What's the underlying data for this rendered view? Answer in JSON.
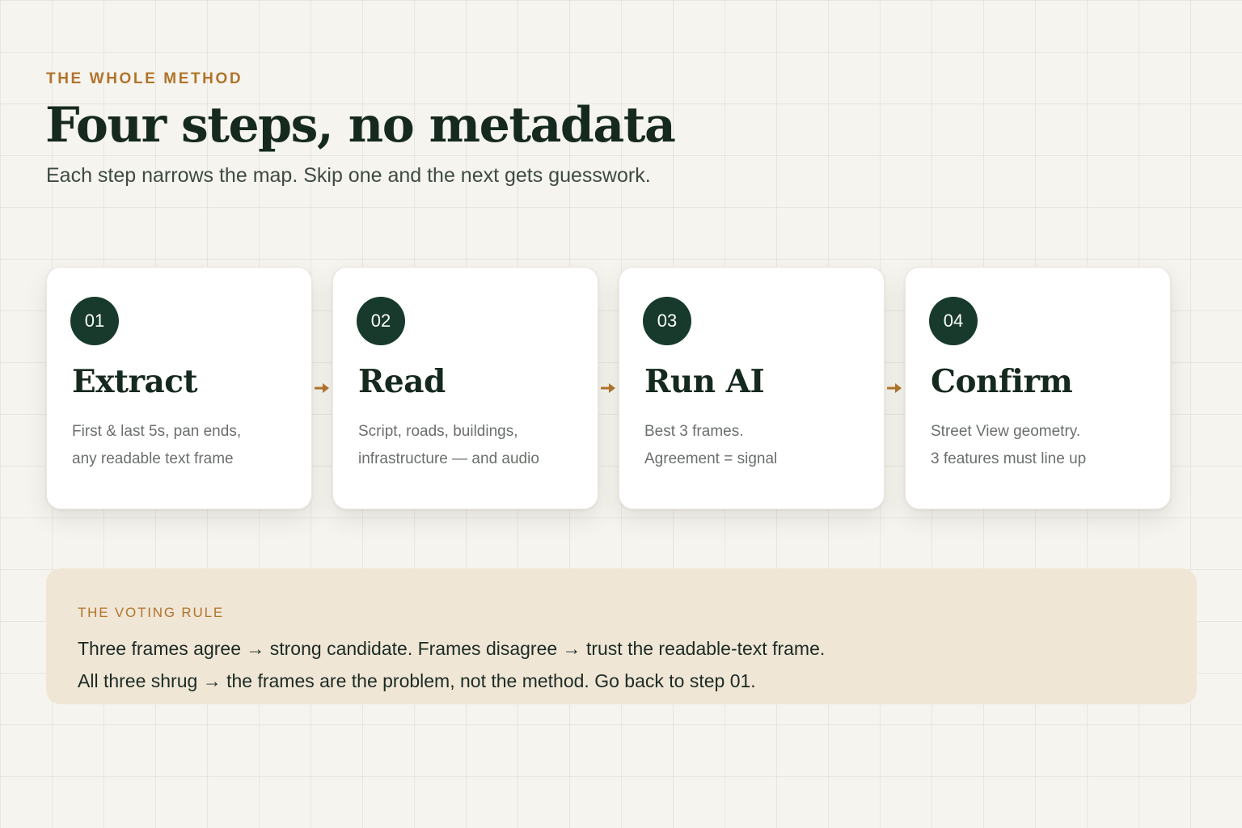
{
  "header": {
    "eyebrow": "THE WHOLE METHOD",
    "title": "Four steps, no metadata",
    "subtitle": "Each step narrows the map. Skip one and the next gets guesswork."
  },
  "steps": [
    {
      "number": "01",
      "title": "Extract",
      "desc_lines": [
        "First & last 5s, pan ends,",
        "any readable text frame"
      ]
    },
    {
      "number": "02",
      "title": "Read",
      "desc_lines": [
        "Script, roads, buildings,",
        "infrastructure — and audio"
      ]
    },
    {
      "number": "03",
      "title": "Run AI",
      "desc_lines": [
        "Best 3 frames.",
        "Agreement = signal"
      ]
    },
    {
      "number": "04",
      "title": "Confirm",
      "desc_lines": [
        "Street View geometry.",
        "3 features must line up"
      ]
    }
  ],
  "arrow_icon": "arrow-right-icon",
  "voting_rule": {
    "label": "THE VOTING RULE",
    "lines": [
      "Three frames agree → strong candidate. Frames disagree → trust the readable-text frame.",
      "All three shrug → the frames are the problem, not the method. Go back to step 01."
    ]
  },
  "colors": {
    "accent": "#b0742c",
    "badge": "#173a2c",
    "heading": "#15291f",
    "panel": "#f0e6d6",
    "background": "#f6f4ee"
  }
}
